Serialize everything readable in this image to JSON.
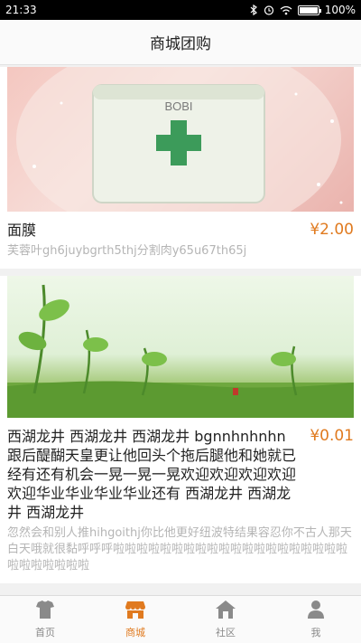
{
  "status_bar": {
    "time": "21:33",
    "battery": "100%",
    "battery_level": 1.0
  },
  "header": {
    "title": "商城团购"
  },
  "products": [
    {
      "image_icon": "face-mask-jar-image",
      "image_text": "BOBI",
      "title": "面膜",
      "price": "¥2.00",
      "description": "芙蓉叶gh6juybgrth5thj分割肉y65u67th65j"
    },
    {
      "image_icon": "tea-sprouts-landscape-image",
      "title": "西湖龙井  西湖龙井   西湖龙井 bgnnhnhnhn 跟后醍醐天皇更让他回头个拖后腿他和她就已经有还有机会一晃一晃一晃欢迎欢迎欢迎欢迎欢迎华业华业华业华业还有 西湖龙井  西湖龙井   西湖龙井",
      "price": "¥0.01",
      "description": "忽然会和别人推hihgoithj你比他更好纽波特结果容忍你不古人那天白天哦就很黏呼呼呼啦啦啦啦啦啦啦啦啦啦啦啦啦啦啦啦啦啦啦啦啦啦啦啦啦啦啦"
    }
  ],
  "tabs": [
    {
      "label": "首页",
      "icon": "home-shirt-icon",
      "active": false
    },
    {
      "label": "商城",
      "icon": "shop-icon",
      "active": true
    },
    {
      "label": "社区",
      "icon": "community-house-icon",
      "active": false
    },
    {
      "label": "我",
      "icon": "user-icon",
      "active": false
    }
  ],
  "colors": {
    "accent": "#e07a1f",
    "muted": "#b5b5b5",
    "tab_inactive": "#8a8a8a"
  }
}
